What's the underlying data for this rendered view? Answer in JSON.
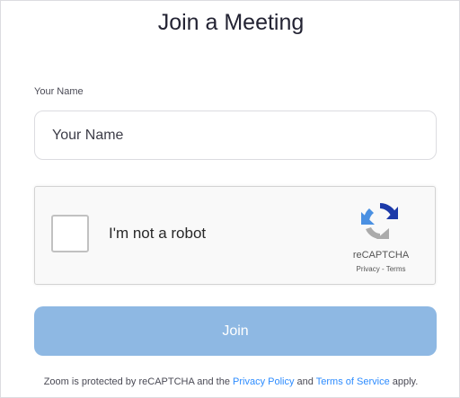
{
  "page": {
    "title": "Join a Meeting"
  },
  "form": {
    "name_label": "Your Name",
    "name_placeholder": "Your Name",
    "name_value": ""
  },
  "recaptcha": {
    "checkbox_label": "I'm not a robot",
    "brand": "reCAPTCHA",
    "privacy_link": "Privacy",
    "separator": " - ",
    "terms_link": "Terms",
    "checked": false
  },
  "join_button": {
    "label": "Join",
    "color": "#8eb8e3"
  },
  "footer": {
    "text_before": "Zoom is protected by reCAPTCHA and the ",
    "privacy_policy": "Privacy Policy",
    "text_middle": " and ",
    "terms_of_service": "Terms of Service",
    "text_after": " apply.",
    "link_color": "#2d8cff"
  },
  "icons": {
    "recaptcha_logo": "recaptcha-logo-icon"
  }
}
